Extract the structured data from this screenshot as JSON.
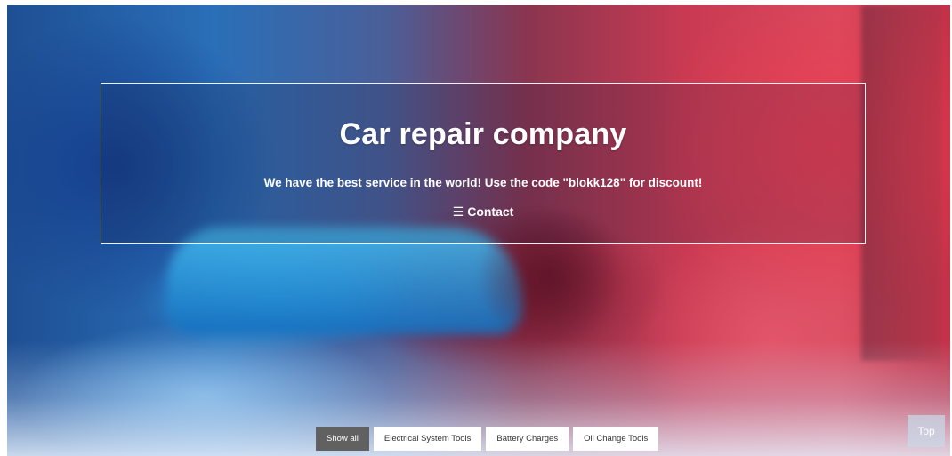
{
  "header": {
    "title": "Car repair company",
    "subtitle": "We have the best service in the world! Use the code \"blokk128\" for discount!",
    "contact_icon": "☰",
    "contact_label": "Contact"
  },
  "filters": [
    {
      "label": "Show all",
      "active": true
    },
    {
      "label": "Electrical System Tools",
      "active": false
    },
    {
      "label": "Battery Charges",
      "active": false
    },
    {
      "label": "Oil Change Tools",
      "active": false
    }
  ],
  "top_button": {
    "label": "Top"
  },
  "colors": {
    "active_filter_bg": "#616161",
    "filter_bg": "#ffffff",
    "text_light": "#ffffff"
  }
}
